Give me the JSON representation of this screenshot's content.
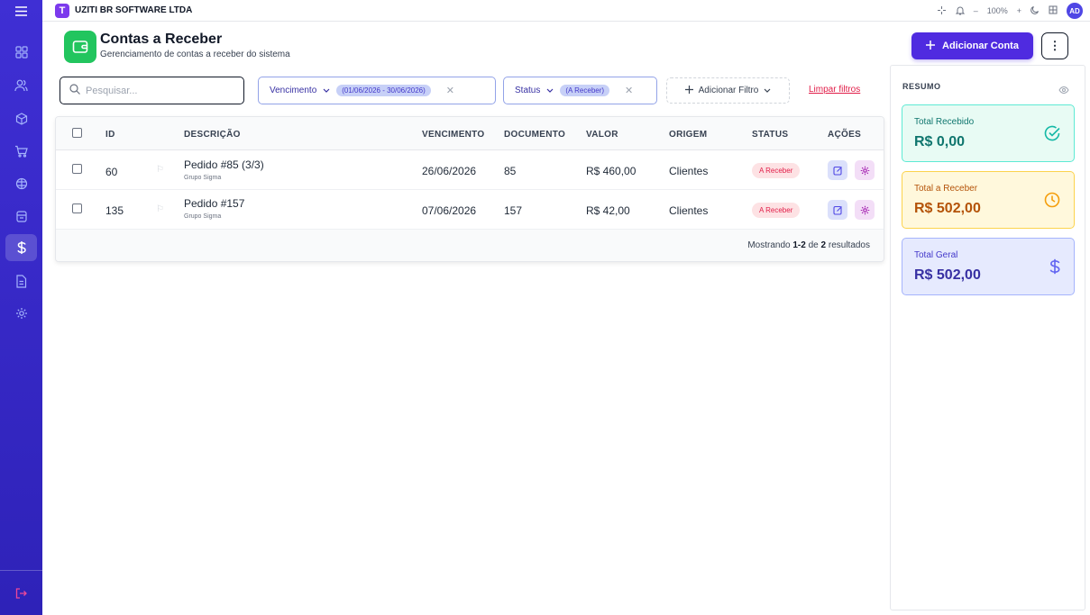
{
  "topbar": {
    "logo_letter": "T",
    "company": "UZITI BR SOFTWARE LTDA",
    "zoom": "100%",
    "zoom_minus": "–",
    "zoom_plus": "+",
    "avatar": "AD"
  },
  "page": {
    "title": "Contas a Receber",
    "subtitle": "Gerenciamento de contas a receber do sistema",
    "add_button": "Adicionar Conta",
    "more_button": "⋮"
  },
  "filters": {
    "search_placeholder": "Pesquisar...",
    "vencimento_label": "Vencimento",
    "vencimento_value": "(01/06/2026 - 30/06/2026)",
    "status_label": "Status",
    "status_value": "(A Receber)",
    "add_filter": "Adicionar Filtro",
    "clear": "Limpar filtros"
  },
  "table": {
    "headers": {
      "id": "ID",
      "descricao": "DESCRIÇÃO",
      "vencimento": "VENCIMENTO",
      "documento": "DOCUMENTO",
      "valor": "VALOR",
      "origem": "ORIGEM",
      "status": "STATUS",
      "acoes": "AÇÕES"
    },
    "rows": [
      {
        "id": "60",
        "descricao": "Pedido #85 (3/3)",
        "cliente": "Grupo Sigma",
        "vencimento": "26/06/2026",
        "documento": "85",
        "valor": "R$ 460,00",
        "origem": "Clientes",
        "status": "A Receber"
      },
      {
        "id": "135",
        "descricao": "Pedido #157",
        "cliente": "Grupo Sigma",
        "vencimento": "07/06/2026",
        "documento": "157",
        "valor": "R$ 42,00",
        "origem": "Clientes",
        "status": "A Receber"
      }
    ],
    "results_prefix": "Mostrando",
    "results_range": "1-2",
    "results_mid": "de",
    "results_total": "2",
    "results_suffix": "resultados"
  },
  "summary": {
    "title": "RESUMO",
    "recebido_label": "Total Recebido",
    "recebido_value": "R$ 0,00",
    "areceber_label": "Total a Receber",
    "areceber_value": "R$ 502,00",
    "geral_label": "Total Geral",
    "geral_value": "R$ 502,00"
  },
  "colors": {
    "sidebar": "#3f2fd4",
    "primary": "#4f2be0",
    "success": "#22c55e",
    "danger": "#e11d48"
  },
  "icons": [
    "menu-icon",
    "dashboard-icon",
    "users-icon",
    "box-icon",
    "cart-icon",
    "package-icon",
    "bank-icon",
    "dollar-icon",
    "document-icon",
    "settings-icon",
    "logout-icon"
  ]
}
